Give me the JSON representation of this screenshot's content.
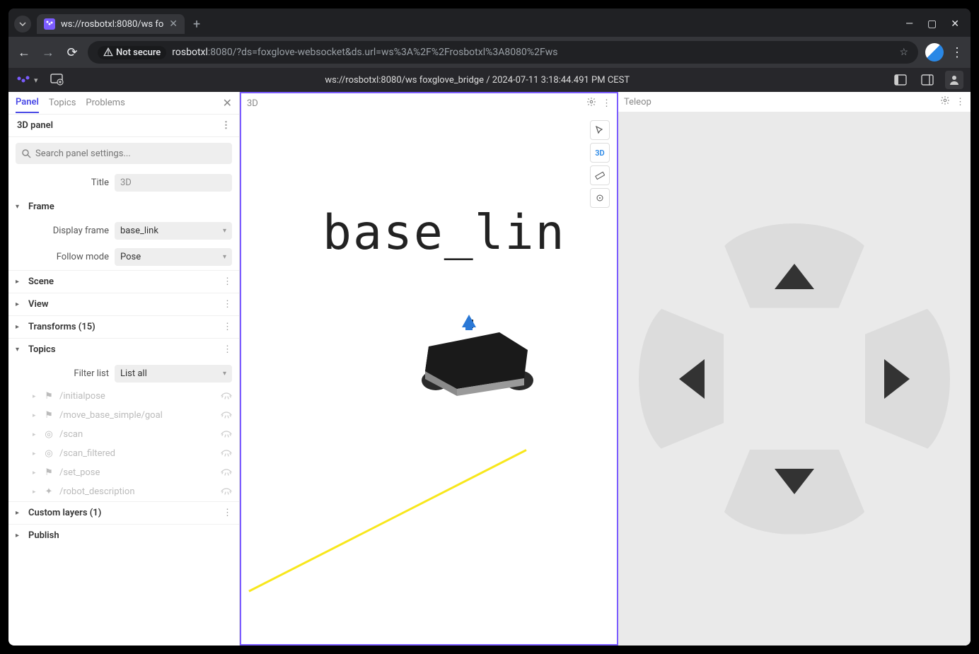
{
  "browser": {
    "tab_title": "ws://rosbotxl:8080/ws fo",
    "url_host": "rosbotxl",
    "url_rest": ":8080/?ds=foxglove-websocket&ds.url=ws%3A%2F%2Frosbotxl%3A8080%2Fws",
    "not_secure": "Not secure"
  },
  "app": {
    "status": "ws://rosbotxl:8080/ws foxglove_bridge / 2024-07-11 3:18:44.491 PM CEST"
  },
  "sidebar": {
    "tabs": {
      "panel": "Panel",
      "topics": "Topics",
      "problems": "Problems"
    },
    "panel_title": "3D panel",
    "search_placeholder": "Search panel settings...",
    "title_label": "Title",
    "title_value": "3D",
    "frame": {
      "section": "Frame",
      "display_frame_label": "Display frame",
      "display_frame_value": "base_link",
      "follow_mode_label": "Follow mode",
      "follow_mode_value": "Pose"
    },
    "scene": "Scene",
    "view": "View",
    "transforms": "Transforms (15)",
    "topics_section": "Topics",
    "filter_list_label": "Filter list",
    "filter_list_value": "List all",
    "topics": [
      {
        "name": "/initialpose",
        "icon": "flag"
      },
      {
        "name": "/move_base_simple/goal",
        "icon": "flag"
      },
      {
        "name": "/scan",
        "icon": "target"
      },
      {
        "name": "/scan_filtered",
        "icon": "target"
      },
      {
        "name": "/set_pose",
        "icon": "flag"
      },
      {
        "name": "/robot_description",
        "icon": "robot"
      }
    ],
    "custom_layers": "Custom layers (1)",
    "publish": "Publish"
  },
  "center": {
    "title": "3D",
    "frame_label": "base_lin",
    "tool_3d": "3D"
  },
  "right": {
    "title": "Teleop"
  }
}
